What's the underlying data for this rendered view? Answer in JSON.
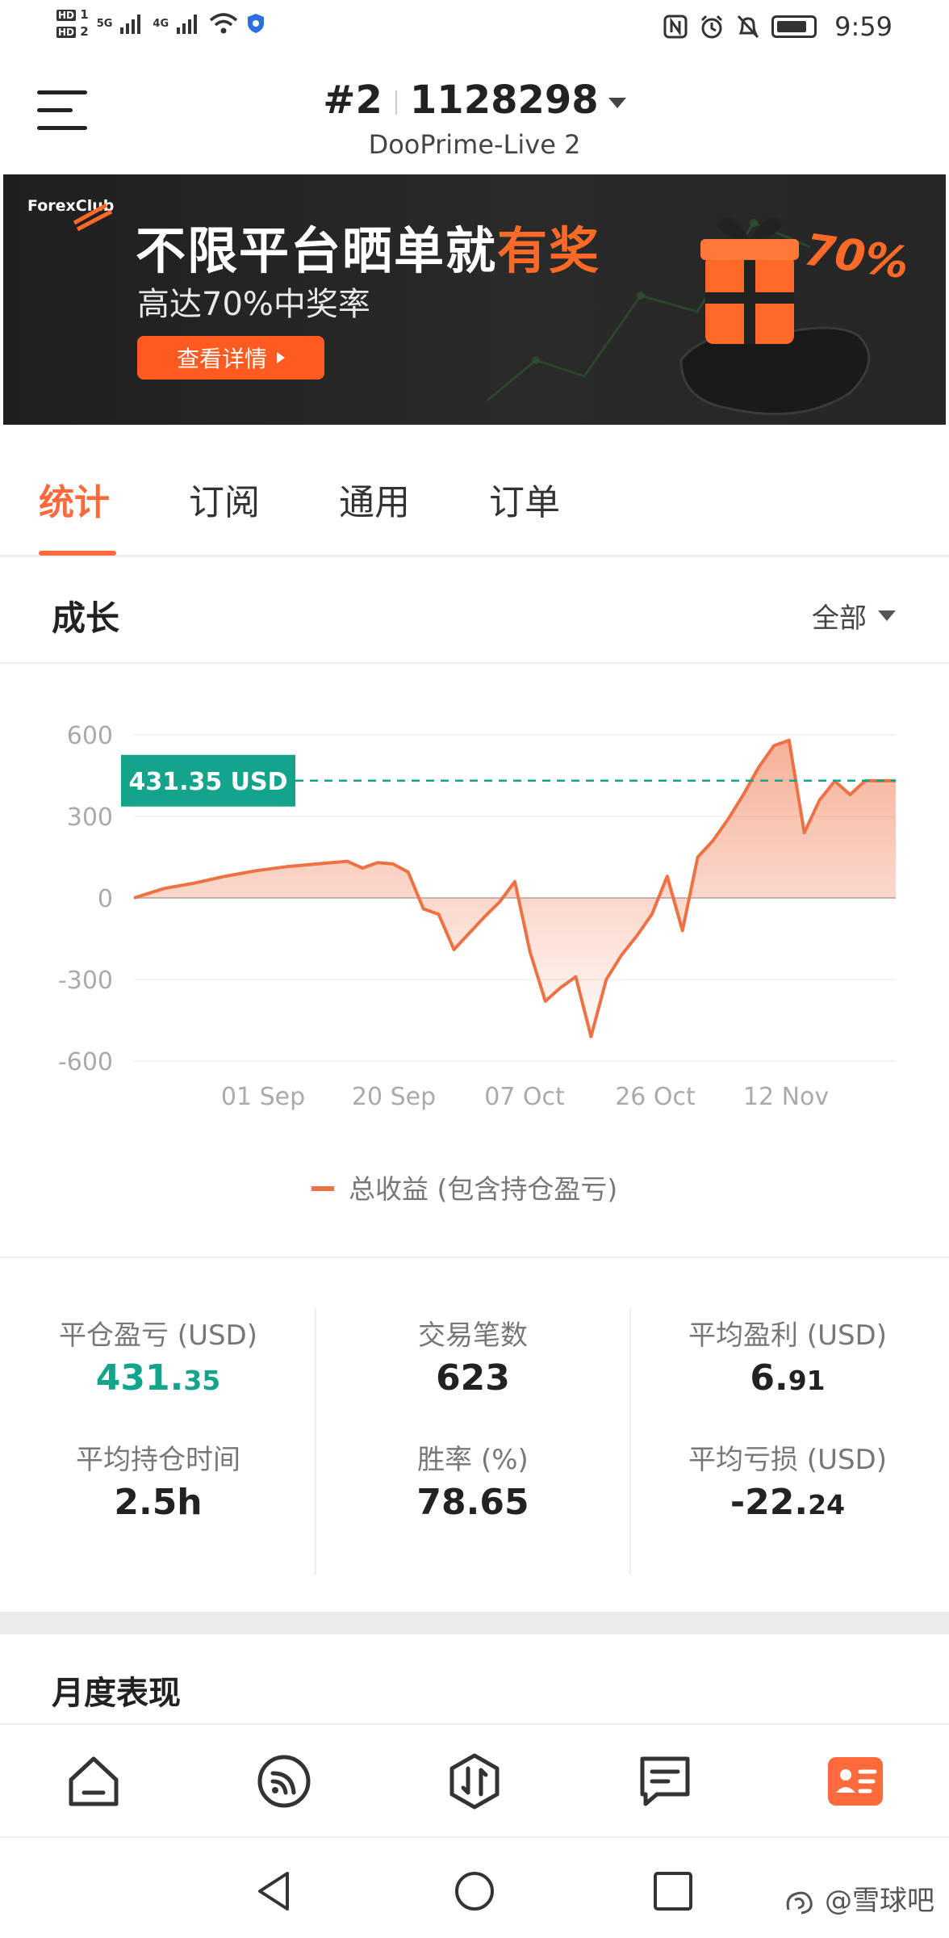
{
  "status_bar": {
    "hd1": "HD",
    "hd1_num": "1",
    "hd2": "HD",
    "hd2_num": "2",
    "net1": "5G",
    "net2": "4G",
    "time": "9:59"
  },
  "header": {
    "account_index": "#2",
    "account_number": "1128298",
    "server": "DooPrime-Live 2"
  },
  "banner": {
    "brand": "ForexClub",
    "headline_main": "不限平台晒单就",
    "headline_highlight": "有奖",
    "subline": "高达70%中奖率",
    "cta": "查看详情",
    "badge": "70%"
  },
  "tabs": [
    {
      "label": "统计",
      "active": true
    },
    {
      "label": "订阅",
      "active": false
    },
    {
      "label": "通用",
      "active": false
    },
    {
      "label": "订单",
      "active": false
    }
  ],
  "growth": {
    "title": "成长",
    "range": "全部"
  },
  "chart_data": {
    "type": "area",
    "y_ticks": [
      "600",
      "300",
      "0",
      "-300",
      "-600"
    ],
    "ylim": [
      -600,
      600
    ],
    "x_ticks": [
      "01 Sep",
      "20 Sep",
      "07 Oct",
      "26 Oct",
      "12 Nov"
    ],
    "current_value_label": "431.35 USD",
    "current_value": 431.35,
    "grid": true,
    "legend_position": "bottom",
    "series": [
      {
        "name": "总收益 (包含持仓盈亏)",
        "color": "#ee7143",
        "x": [
          0,
          4,
          8,
          12,
          16,
          20,
          24,
          28,
          30,
          32,
          34,
          36,
          38,
          40,
          42,
          44,
          46,
          48,
          50,
          52,
          54,
          56,
          58,
          60,
          62,
          64,
          66,
          68,
          70,
          72,
          74,
          76,
          78,
          80,
          81,
          82,
          84,
          86,
          88,
          90,
          92,
          94,
          96,
          98,
          100
        ],
        "y": [
          0,
          35,
          55,
          80,
          100,
          115,
          125,
          135,
          110,
          130,
          125,
          95,
          -40,
          -60,
          -190,
          -130,
          -70,
          -15,
          60,
          -200,
          -380,
          -330,
          -290,
          -510,
          -300,
          -210,
          -140,
          -60,
          80,
          -120,
          150,
          210,
          290,
          380,
          430,
          480,
          560,
          580,
          240,
          360,
          430,
          380,
          431,
          431,
          431
        ]
      }
    ]
  },
  "stats": {
    "closed_pl_label": "平仓盈亏 (USD)",
    "closed_pl_int": "431.",
    "closed_pl_dec": "35",
    "trades_label": "交易笔数",
    "trades_value": "623",
    "avg_profit_label": "平均盈利 (USD)",
    "avg_profit_int": "6.",
    "avg_profit_dec": "91",
    "avg_hold_label": "平均持仓时间",
    "avg_hold_value": "2.5h",
    "win_rate_label": "胜率 (%)",
    "win_rate_value": "78.65",
    "avg_loss_label": "平均亏损 (USD)",
    "avg_loss_int": "-22.",
    "avg_loss_dec": "24"
  },
  "monthly": {
    "title": "月度表现"
  },
  "bottom_nav": {
    "items": [
      "home-icon",
      "feed-icon",
      "trade-icon",
      "message-icon",
      "profile-icon"
    ],
    "active_index": 4,
    "accent": "#ff6a3d"
  },
  "watermark": "@雪球吧"
}
